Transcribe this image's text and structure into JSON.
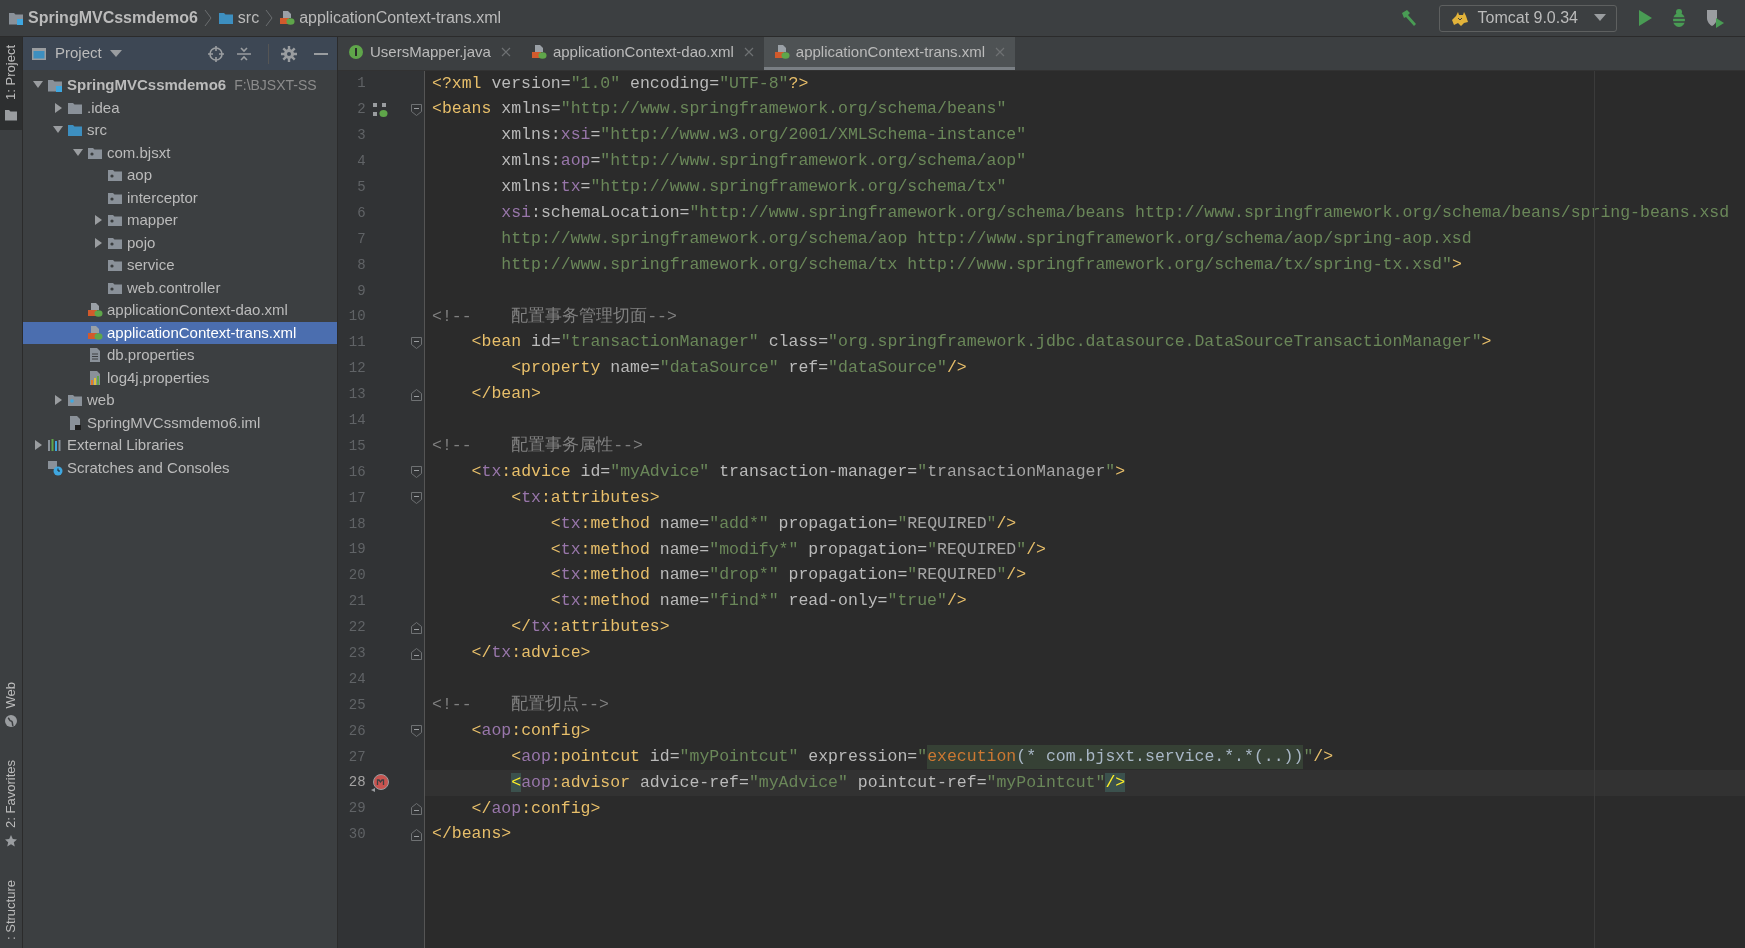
{
  "breadcrumbs": [
    {
      "label": "SpringMVCssmdemo6",
      "kind": "module"
    },
    {
      "label": "src",
      "kind": "source"
    },
    {
      "label": "applicationContext-trans.xml",
      "kind": "xml"
    }
  ],
  "run_config": {
    "label": "Tomcat 9.0.34"
  },
  "tool_strip": {
    "top": [
      {
        "label": "1: Project",
        "kind": "folder",
        "selected": true
      }
    ],
    "bottom": [
      {
        "label": "Web",
        "kind": "globe",
        "selected": false
      },
      {
        "label": "2: Favorites",
        "kind": "star",
        "selected": false
      },
      {
        "label": ": Structure",
        "selected": false
      }
    ]
  },
  "project_panel": {
    "title": "Project",
    "tree": [
      {
        "label": "SpringMVCssmdemo6",
        "path": "F:\\BJSXT-SS",
        "kind": "module",
        "expanded": true,
        "selected": false,
        "children": [
          {
            "label": ".idea",
            "kind": "folder",
            "expanded": false,
            "selected": false
          },
          {
            "label": "src",
            "kind": "source",
            "expanded": true,
            "selected": false,
            "children": [
              {
                "label": "com.bjsxt",
                "kind": "package",
                "expanded": true,
                "selected": false,
                "children": [
                  {
                    "label": "aop",
                    "kind": "package",
                    "selected": false
                  },
                  {
                    "label": "interceptor",
                    "kind": "package",
                    "selected": false
                  },
                  {
                    "label": "mapper",
                    "kind": "package",
                    "expanded": false,
                    "selected": false
                  },
                  {
                    "label": "pojo",
                    "kind": "package",
                    "expanded": false,
                    "selected": false
                  },
                  {
                    "label": "service",
                    "kind": "package",
                    "selected": false
                  },
                  {
                    "label": "web.controller",
                    "kind": "package",
                    "selected": false
                  }
                ]
              },
              {
                "label": "applicationContext-dao.xml",
                "kind": "xml",
                "selected": false
              },
              {
                "label": "applicationContext-trans.xml",
                "kind": "xml",
                "selected": true
              },
              {
                "label": "db.properties",
                "kind": "props",
                "selected": false
              },
              {
                "label": "log4j.properties",
                "kind": "log4j",
                "selected": false
              }
            ]
          },
          {
            "label": "web",
            "kind": "web",
            "expanded": false,
            "selected": false
          },
          {
            "label": "SpringMVCssmdemo6.iml",
            "kind": "iml",
            "selected": false
          }
        ]
      },
      {
        "label": "External Libraries",
        "kind": "library",
        "expanded": false,
        "selected": false
      },
      {
        "label": "Scratches and Consoles",
        "kind": "scratch",
        "selected": false
      }
    ]
  },
  "editor": {
    "tabs": [
      {
        "label": "UsersMapper.java",
        "kind": "interface",
        "selected": false
      },
      {
        "label": "applicationContext-dao.xml",
        "kind": "xml",
        "selected": false
      },
      {
        "label": "applicationContext-trans.xml",
        "kind": "xml",
        "selected": true
      }
    ],
    "lines": [
      {
        "number": "1",
        "current": false,
        "tokens": [
          {
            "kind": "tag",
            "text": "<?xml"
          },
          {
            "kind": "attr",
            "text": " version="
          },
          {
            "kind": "val",
            "text": "\"1.0\""
          },
          {
            "kind": "attr",
            "text": " encoding="
          },
          {
            "kind": "val",
            "text": "\"UTF-8\""
          },
          {
            "kind": "tag",
            "text": "?>"
          }
        ]
      },
      {
        "number": "2",
        "current": false,
        "gutter": {
          "kind": "bean"
        },
        "fold": {
          "kind": "start"
        },
        "tokens": [
          {
            "kind": "tag",
            "text": "<beans"
          },
          {
            "kind": "attr",
            "text": " xmlns="
          },
          {
            "kind": "val",
            "text": "\"http://www.springframework.org/schema/beans\""
          }
        ]
      },
      {
        "number": "3",
        "current": false,
        "tokens": [
          {
            "kind": "attr",
            "text": "       xmlns:"
          },
          {
            "kind": "ns",
            "text": "xsi"
          },
          {
            "kind": "attr",
            "text": "="
          },
          {
            "kind": "val",
            "text": "\"http://www.w3.org/2001/XMLSchema-instance\""
          }
        ]
      },
      {
        "number": "4",
        "current": false,
        "tokens": [
          {
            "kind": "attr",
            "text": "       xmlns:"
          },
          {
            "kind": "ns",
            "text": "aop"
          },
          {
            "kind": "attr",
            "text": "="
          },
          {
            "kind": "val",
            "text": "\"http://www.springframework.org/schema/aop\""
          }
        ]
      },
      {
        "number": "5",
        "current": false,
        "tokens": [
          {
            "kind": "attr",
            "text": "       xmlns:"
          },
          {
            "kind": "ns",
            "text": "tx"
          },
          {
            "kind": "attr",
            "text": "="
          },
          {
            "kind": "val",
            "text": "\"http://www.springframework.org/schema/tx\""
          }
        ]
      },
      {
        "number": "6",
        "current": false,
        "tokens": [
          {
            "kind": "ns",
            "text": "       xsi"
          },
          {
            "kind": "attr",
            "text": ":schemaLocation="
          },
          {
            "kind": "val",
            "text": "\"http://www.springframework.org/schema/beans http://www.springframework.org/schema/beans/spring-beans.xsd"
          }
        ]
      },
      {
        "number": "7",
        "current": false,
        "tokens": [
          {
            "kind": "val",
            "text": "       http://www.springframework.org/schema/aop http://www.springframework.org/schema/aop/spring-aop.xsd"
          }
        ]
      },
      {
        "number": "8",
        "current": false,
        "tokens": [
          {
            "kind": "val",
            "text": "       http://www.springframework.org/schema/tx http://www.springframework.org/schema/tx/spring-tx.xsd\""
          },
          {
            "kind": "tag",
            "text": ">"
          }
        ]
      },
      {
        "number": "9",
        "current": false
      },
      {
        "number": "10",
        "current": false,
        "tokens": [
          {
            "kind": "comment",
            "text": "<!--    配置事务管理切面-->"
          }
        ]
      },
      {
        "number": "11",
        "current": false,
        "fold": {
          "kind": "start"
        },
        "tokens": [
          {
            "kind": "tag",
            "text": "    <bean"
          },
          {
            "kind": "attr",
            "text": " id="
          },
          {
            "kind": "val",
            "text": "\"transactionManager\""
          },
          {
            "kind": "attr",
            "text": " class="
          },
          {
            "kind": "val",
            "text": "\"org.springframework.jdbc.datasource.DataSourceTransactionManager\""
          },
          {
            "kind": "tag",
            "text": ">"
          }
        ]
      },
      {
        "number": "12",
        "current": false,
        "tokens": [
          {
            "kind": "tag",
            "text": "        <property"
          },
          {
            "kind": "attr",
            "text": " name="
          },
          {
            "kind": "val",
            "text": "\"dataSource\""
          },
          {
            "kind": "attr",
            "text": " ref="
          },
          {
            "kind": "val",
            "text": "\"dataSource\""
          },
          {
            "kind": "tag",
            "text": "/>"
          }
        ]
      },
      {
        "number": "13",
        "current": false,
        "fold": {
          "kind": "end"
        },
        "tokens": [
          {
            "kind": "tag",
            "text": "    </bean>"
          }
        ]
      },
      {
        "number": "14",
        "current": false
      },
      {
        "number": "15",
        "current": false,
        "tokens": [
          {
            "kind": "comment",
            "text": "<!--    配置事务属性-->"
          }
        ]
      },
      {
        "number": "16",
        "current": false,
        "fold": {
          "kind": "start"
        },
        "tokens": [
          {
            "kind": "tag",
            "text": "    <"
          },
          {
            "kind": "ns",
            "text": "tx"
          },
          {
            "kind": "tag",
            "text": ":advice"
          },
          {
            "kind": "attr",
            "text": " id="
          },
          {
            "kind": "val",
            "text": "\"myAdvice\""
          },
          {
            "kind": "attr",
            "text": " transaction-manager="
          },
          {
            "kind": "val",
            "text": "\""
          },
          {
            "kind": "ref",
            "text": "transactionManager"
          },
          {
            "kind": "val",
            "text": "\""
          },
          {
            "kind": "tag",
            "text": ">"
          }
        ]
      },
      {
        "number": "17",
        "current": false,
        "fold": {
          "kind": "start"
        },
        "tokens": [
          {
            "kind": "tag",
            "text": "        <"
          },
          {
            "kind": "ns",
            "text": "tx"
          },
          {
            "kind": "tag",
            "text": ":attributes>"
          }
        ]
      },
      {
        "number": "18",
        "current": false,
        "tokens": [
          {
            "kind": "tag",
            "text": "            <"
          },
          {
            "kind": "ns",
            "text": "tx"
          },
          {
            "kind": "tag",
            "text": ":method"
          },
          {
            "kind": "attr",
            "text": " name="
          },
          {
            "kind": "val",
            "text": "\"add*\""
          },
          {
            "kind": "attr",
            "text": " propagation="
          },
          {
            "kind": "val",
            "text": "\""
          },
          {
            "kind": "ref",
            "text": "REQUIRED"
          },
          {
            "kind": "val",
            "text": "\""
          },
          {
            "kind": "tag",
            "text": "/>"
          }
        ]
      },
      {
        "number": "19",
        "current": false,
        "tokens": [
          {
            "kind": "tag",
            "text": "            <"
          },
          {
            "kind": "ns",
            "text": "tx"
          },
          {
            "kind": "tag",
            "text": ":method"
          },
          {
            "kind": "attr",
            "text": " name="
          },
          {
            "kind": "val",
            "text": "\"modify*\""
          },
          {
            "kind": "attr",
            "text": " propagation="
          },
          {
            "kind": "val",
            "text": "\""
          },
          {
            "kind": "ref",
            "text": "REQUIRED"
          },
          {
            "kind": "val",
            "text": "\""
          },
          {
            "kind": "tag",
            "text": "/>"
          }
        ]
      },
      {
        "number": "20",
        "current": false,
        "tokens": [
          {
            "kind": "tag",
            "text": "            <"
          },
          {
            "kind": "ns",
            "text": "tx"
          },
          {
            "kind": "tag",
            "text": ":method"
          },
          {
            "kind": "attr",
            "text": " name="
          },
          {
            "kind": "val",
            "text": "\"drop*\""
          },
          {
            "kind": "attr",
            "text": " propagation="
          },
          {
            "kind": "val",
            "text": "\""
          },
          {
            "kind": "ref",
            "text": "REQUIRED"
          },
          {
            "kind": "val",
            "text": "\""
          },
          {
            "kind": "tag",
            "text": "/>"
          }
        ]
      },
      {
        "number": "21",
        "current": false,
        "tokens": [
          {
            "kind": "tag",
            "text": "            <"
          },
          {
            "kind": "ns",
            "text": "tx"
          },
          {
            "kind": "tag",
            "text": ":method"
          },
          {
            "kind": "attr",
            "text": " name="
          },
          {
            "kind": "val",
            "text": "\"find*\""
          },
          {
            "kind": "attr",
            "text": " read-only="
          },
          {
            "kind": "val",
            "text": "\"true\""
          },
          {
            "kind": "tag",
            "text": "/>"
          }
        ]
      },
      {
        "number": "22",
        "current": false,
        "fold": {
          "kind": "end"
        },
        "tokens": [
          {
            "kind": "tag",
            "text": "        </"
          },
          {
            "kind": "ns",
            "text": "tx"
          },
          {
            "kind": "tag",
            "text": ":attributes>"
          }
        ]
      },
      {
        "number": "23",
        "current": false,
        "fold": {
          "kind": "end"
        },
        "tokens": [
          {
            "kind": "tag",
            "text": "    </"
          },
          {
            "kind": "ns",
            "text": "tx"
          },
          {
            "kind": "tag",
            "text": ":advice>"
          }
        ]
      },
      {
        "number": "24",
        "current": false
      },
      {
        "number": "25",
        "current": false,
        "tokens": [
          {
            "kind": "comment",
            "text": "<!--    配置切点-->"
          }
        ]
      },
      {
        "number": "26",
        "current": false,
        "fold": {
          "kind": "start"
        },
        "tokens": [
          {
            "kind": "tag",
            "text": "    <"
          },
          {
            "kind": "ns",
            "text": "aop"
          },
          {
            "kind": "tag",
            "text": ":config>"
          }
        ]
      },
      {
        "number": "27",
        "current": false,
        "tokens": [
          {
            "kind": "tag",
            "text": "        <"
          },
          {
            "kind": "ns",
            "text": "aop"
          },
          {
            "kind": "tag",
            "text": ":pointcut"
          },
          {
            "kind": "attr",
            "text": " id="
          },
          {
            "kind": "val",
            "text": "\"myPointcut\""
          },
          {
            "kind": "attr",
            "text": " expression="
          },
          {
            "kind": "val",
            "text": "\""
          },
          {
            "kind": "inj",
            "text": "execution"
          },
          {
            "kind": "injtext",
            "text": "(* com.bjsxt.service.*.*(..))"
          },
          {
            "kind": "val",
            "text": "\""
          },
          {
            "kind": "tag",
            "text": "/>"
          }
        ]
      },
      {
        "number": "28",
        "current": true,
        "gutter": {
          "kind": "method"
        },
        "tokens": [
          {
            "kind": "match",
            "text": "        <"
          },
          {
            "kind": "ns",
            "text": "aop"
          },
          {
            "kind": "tag",
            "text": ":advisor"
          },
          {
            "kind": "attr",
            "text": " advice-ref="
          },
          {
            "kind": "val",
            "text": "\"myAdvice\""
          },
          {
            "kind": "attr",
            "text": " pointcut-ref="
          },
          {
            "kind": "val",
            "text": "\"myPointcut\""
          },
          {
            "kind": "match",
            "text": "/>"
          }
        ]
      },
      {
        "number": "29",
        "current": false,
        "fold": {
          "kind": "end"
        },
        "tokens": [
          {
            "kind": "tag",
            "text": "    </"
          },
          {
            "kind": "ns",
            "text": "aop"
          },
          {
            "kind": "tag",
            "text": ":config>"
          }
        ]
      },
      {
        "number": "30",
        "current": false,
        "fold": {
          "kind": "end"
        },
        "tokens": [
          {
            "kind": "tag",
            "text": "</beans>"
          }
        ]
      }
    ]
  }
}
